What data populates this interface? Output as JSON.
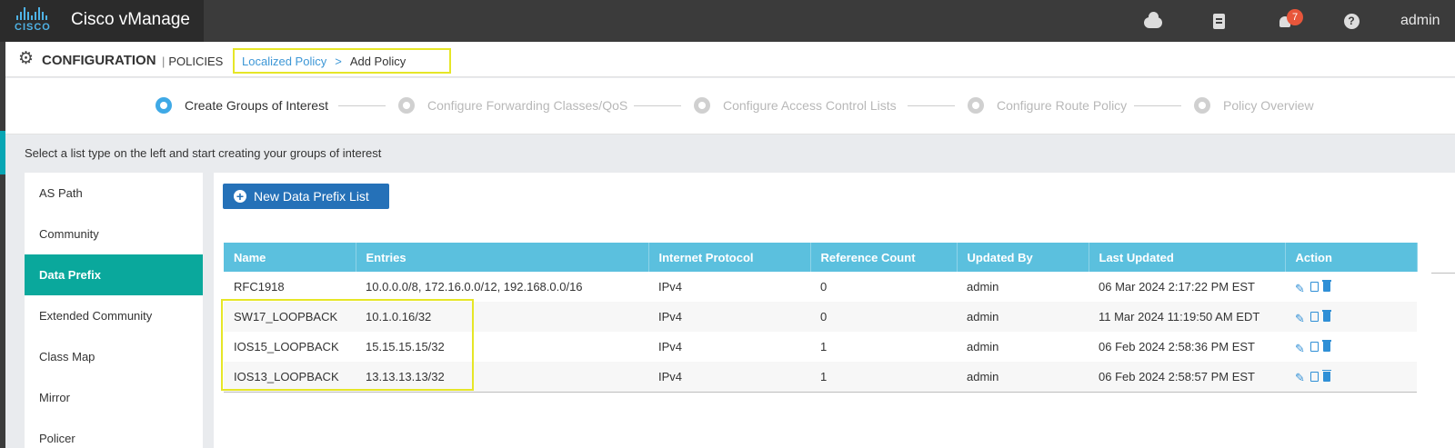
{
  "app": {
    "title": "Cisco vManage",
    "logo_word": "CISCO"
  },
  "topbar": {
    "icons": [
      "cloud-icon",
      "clipboard-icon",
      "bell-icon",
      "help-icon"
    ],
    "notification_count": "7",
    "help_glyph": "?",
    "user": "admin"
  },
  "config": {
    "title": "CONFIGURATION",
    "subtitle": "POLICIES",
    "pipe": "|"
  },
  "breadcrumb": {
    "parent": "Localized Policy",
    "separator": ">",
    "current": "Add Policy"
  },
  "steps": [
    {
      "label": "Create Groups of Interest",
      "active": true
    },
    {
      "label": "Configure Forwarding Classes/QoS",
      "active": false
    },
    {
      "label": "Configure Access Control Lists",
      "active": false
    },
    {
      "label": "Configure Route Policy",
      "active": false
    },
    {
      "label": "Policy Overview",
      "active": false
    }
  ],
  "instructions": "Select a list type on the left and start creating your groups of interest",
  "list_types": [
    {
      "label": "AS Path",
      "selected": false
    },
    {
      "label": "Community",
      "selected": false
    },
    {
      "label": "Data Prefix",
      "selected": true
    },
    {
      "label": "Extended Community",
      "selected": false
    },
    {
      "label": "Class Map",
      "selected": false
    },
    {
      "label": "Mirror",
      "selected": false
    },
    {
      "label": "Policer",
      "selected": false
    }
  ],
  "new_button": {
    "label": "New Data Prefix List"
  },
  "table": {
    "columns": [
      "Name",
      "Entries",
      "Internet Protocol",
      "Reference Count",
      "Updated By",
      "Last Updated",
      "Action"
    ],
    "rows": [
      {
        "name": "RFC1918",
        "entries": "10.0.0.0/8, 172.16.0.0/12, 192.168.0.0/16",
        "protocol": "IPv4",
        "ref_count": "0",
        "updated_by": "admin",
        "last_updated": "06 Mar 2024 2:17:22 PM EST"
      },
      {
        "name": "SW17_LOOPBACK",
        "entries": "10.1.0.16/32",
        "protocol": "IPv4",
        "ref_count": "0",
        "updated_by": "admin",
        "last_updated": "11 Mar 2024 11:19:50 AM EDT"
      },
      {
        "name": "IOS15_LOOPBACK",
        "entries": "15.15.15.15/32",
        "protocol": "IPv4",
        "ref_count": "1",
        "updated_by": "admin",
        "last_updated": "06 Feb 2024 2:58:36 PM EST"
      },
      {
        "name": "IOS13_LOOPBACK",
        "entries": "13.13.13.13/32",
        "protocol": "IPv4",
        "ref_count": "1",
        "updated_by": "admin",
        "last_updated": "06 Feb 2024 2:58:57 PM EST"
      }
    ]
  },
  "colors": {
    "accent_teal": "#0aa89c",
    "header_blue": "#5bc0de",
    "button_blue": "#2571b8",
    "link_blue": "#3d97d6",
    "highlight_yellow": "#e6e627",
    "badge_red": "#e8563b"
  }
}
